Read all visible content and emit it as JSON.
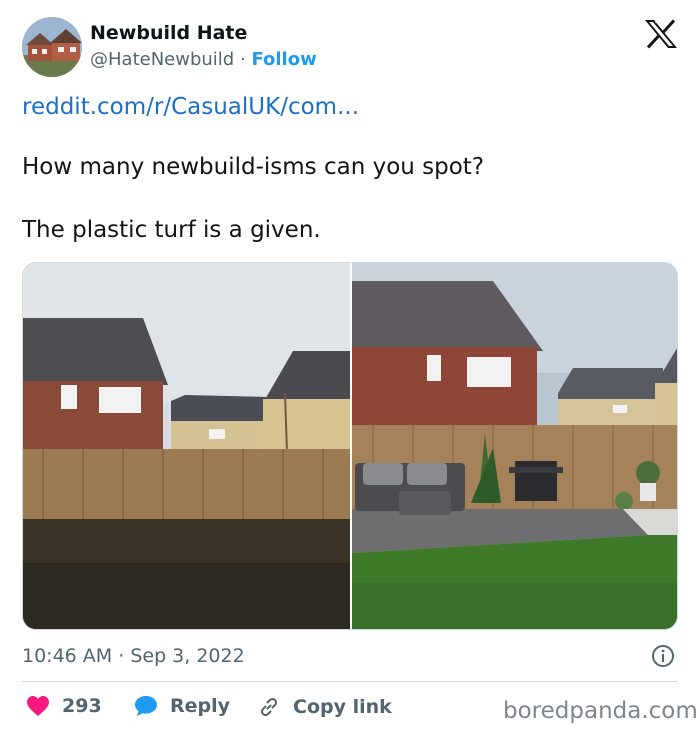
{
  "user": {
    "display_name": "Newbuild Hate",
    "handle": "@HateNewbuild",
    "separator": "·",
    "follow_label": "Follow"
  },
  "tweet": {
    "link_text": "reddit.com/r/CasualUK/com...",
    "lines": [
      "How many newbuild-isms can you spot?",
      "The plastic turf is a given."
    ]
  },
  "meta": {
    "time": "10:46 AM",
    "separator": "·",
    "date": "Sep 3, 2022"
  },
  "actions": {
    "likes": "293",
    "reply_label": "Reply",
    "copy_label": "Copy link"
  },
  "watermark": "boredpanda.com",
  "colors": {
    "link": "#1d6fc7",
    "follow": "#1d9bf0",
    "heart": "#f91880",
    "muted": "#536471"
  },
  "icons": [
    "x-logo-icon",
    "info-icon",
    "heart-icon",
    "reply-bubble-icon",
    "link-icon"
  ]
}
